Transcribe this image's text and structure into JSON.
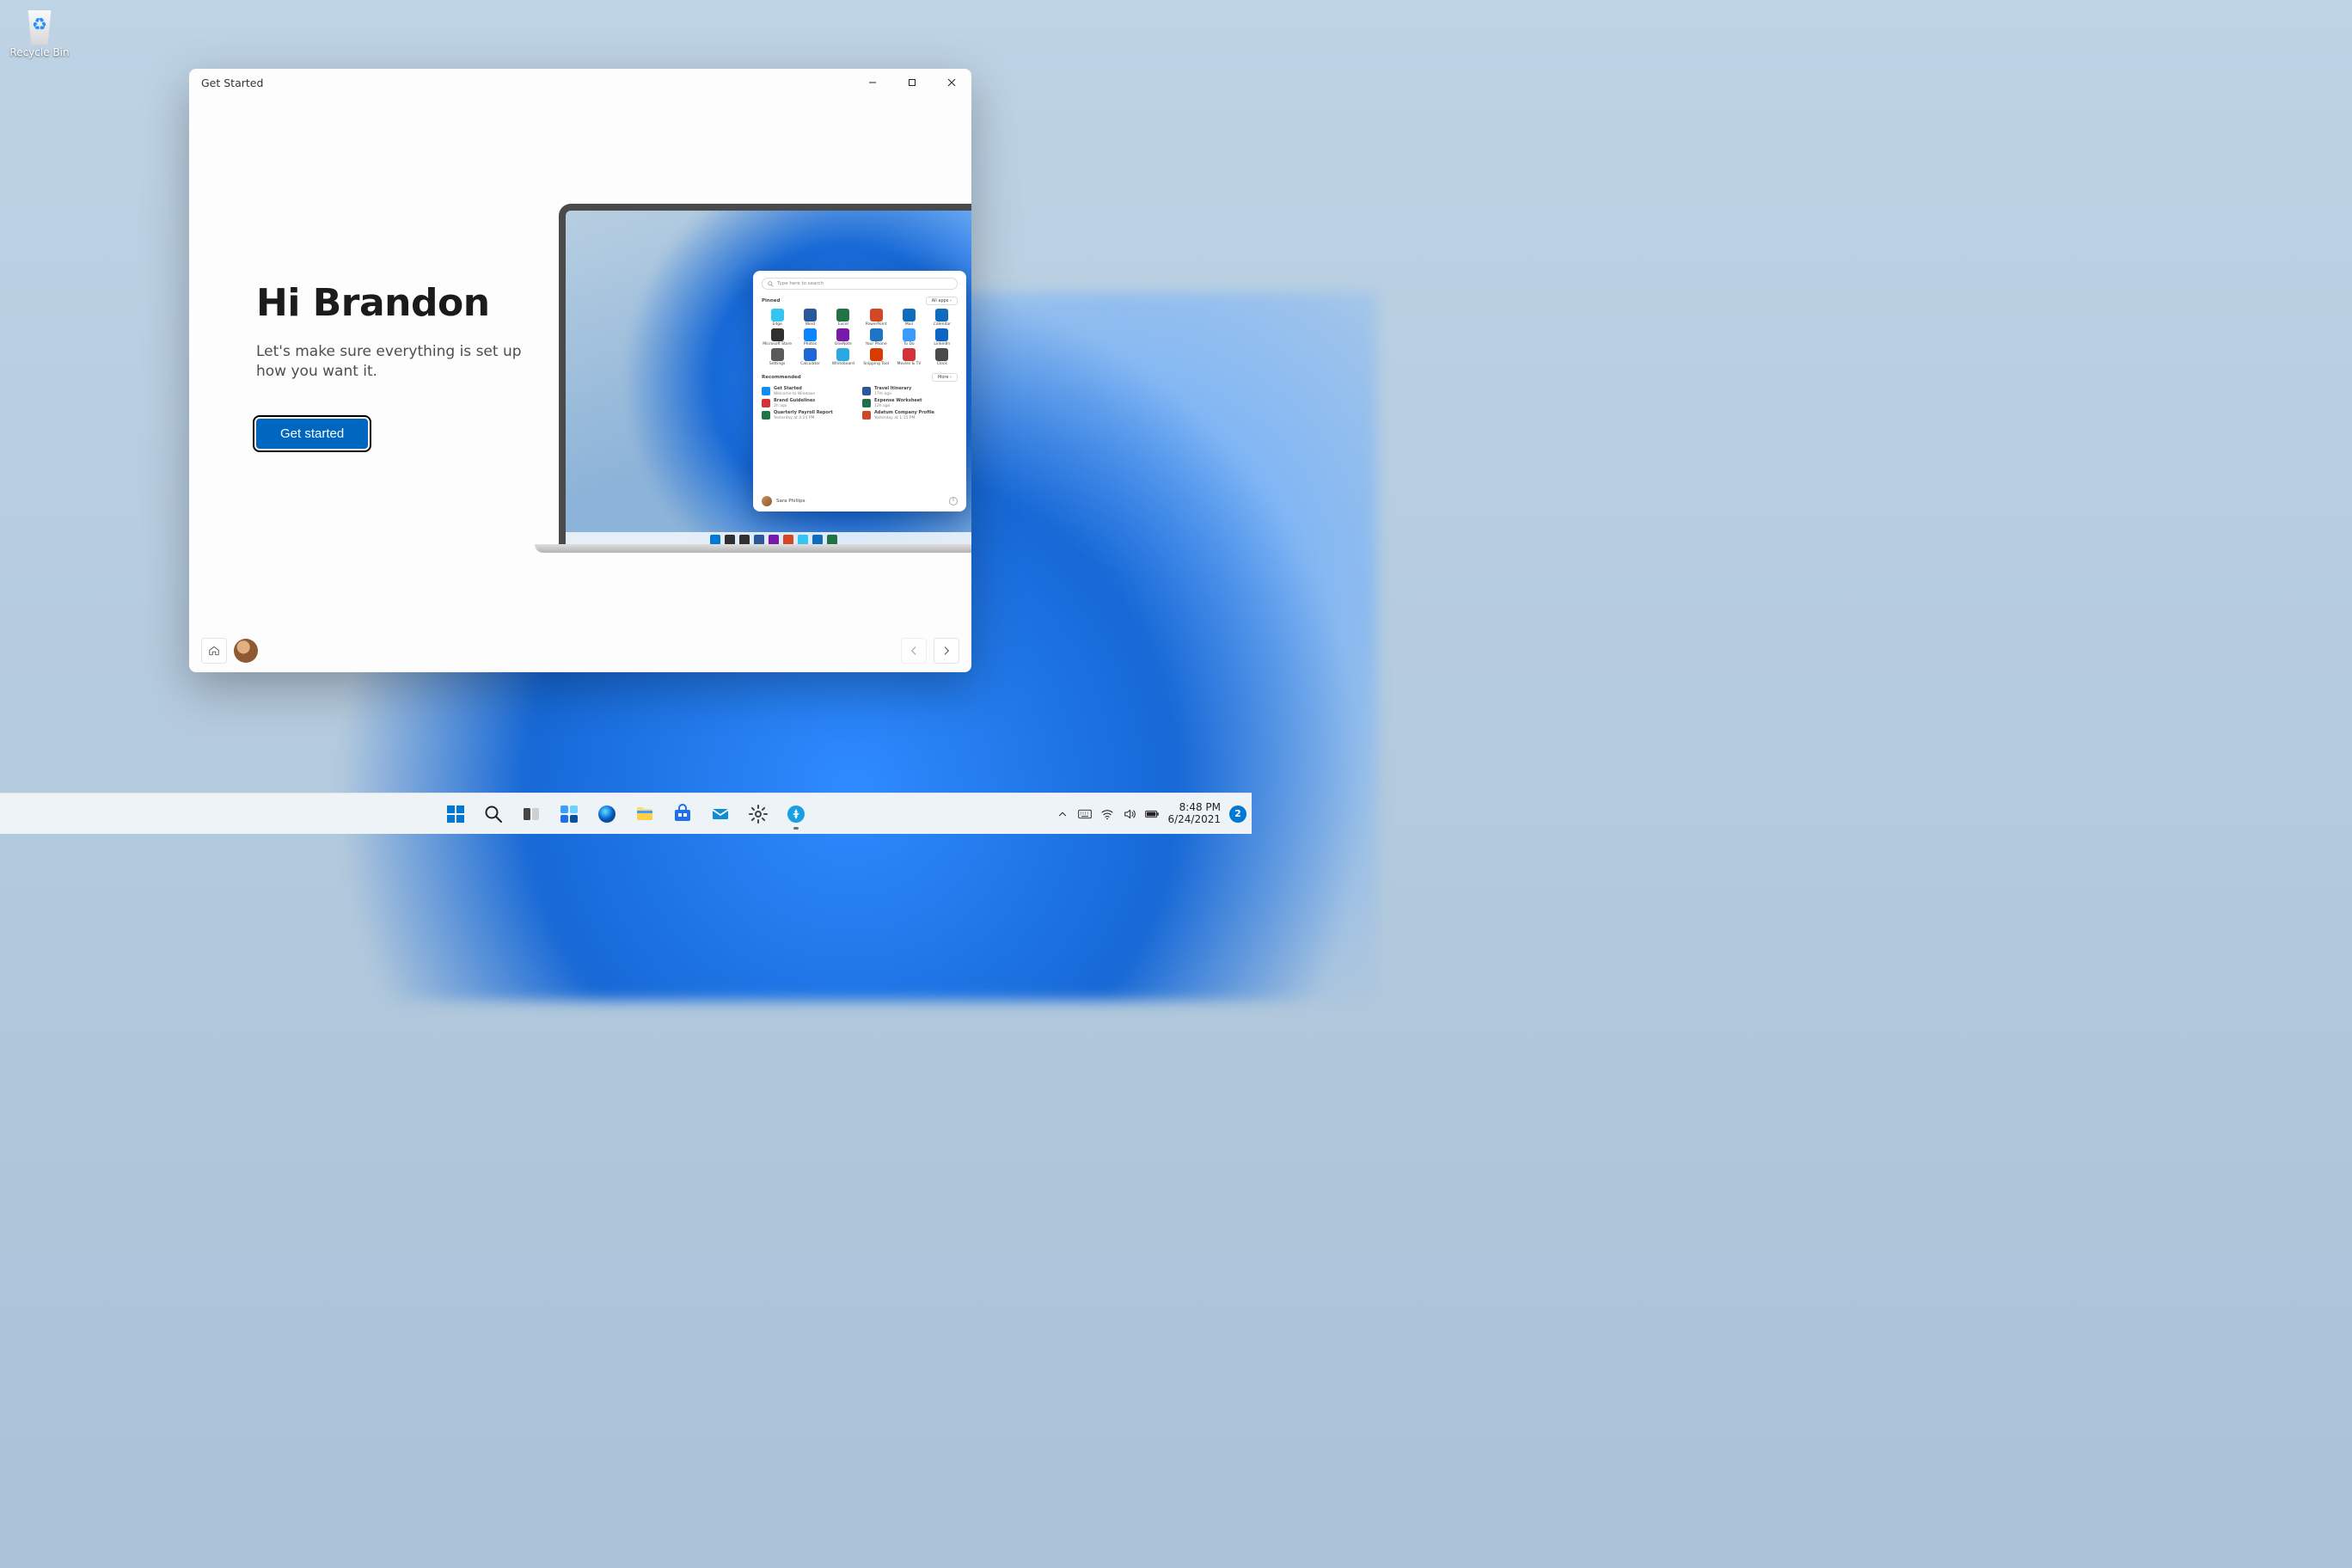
{
  "desktop": {
    "recycle_bin_label": "Recycle Bin"
  },
  "window": {
    "title": "Get Started",
    "greeting": "Hi Brandon",
    "subhead": "Let's make sure everything is set up how you want it.",
    "cta": "Get started"
  },
  "hero_start_menu": {
    "search_placeholder": "Type here to search",
    "pinned_label": "Pinned",
    "all_apps_label": "All apps",
    "recommended_label": "Recommended",
    "more_label": "More",
    "user_name": "Sara Phillips",
    "pinned": [
      {
        "label": "Edge",
        "color": "#35c3f0"
      },
      {
        "label": "Word",
        "color": "#2b579a"
      },
      {
        "label": "Excel",
        "color": "#217346"
      },
      {
        "label": "PowerPoint",
        "color": "#d24726"
      },
      {
        "label": "Mail",
        "color": "#0f6cbd"
      },
      {
        "label": "Calendar",
        "color": "#0f6cbd"
      },
      {
        "label": "Microsoft Store",
        "color": "#303030"
      },
      {
        "label": "Photos",
        "color": "#0a84ff"
      },
      {
        "label": "OneNote",
        "color": "#7719aa"
      },
      {
        "label": "Your Phone",
        "color": "#1b74c5"
      },
      {
        "label": "To Do",
        "color": "#3a9bff"
      },
      {
        "label": "LinkedIn",
        "color": "#0a66c2"
      },
      {
        "label": "Settings",
        "color": "#5a5a5a"
      },
      {
        "label": "Calculator",
        "color": "#2067d4"
      },
      {
        "label": "Whiteboard",
        "color": "#2aa8e0"
      },
      {
        "label": "Snipping Tool",
        "color": "#d83b01"
      },
      {
        "label": "Movies & TV",
        "color": "#d13438"
      },
      {
        "label": "Clock",
        "color": "#4a4a4a"
      }
    ],
    "recommended": [
      {
        "title": "Get Started",
        "sub": "Welcome to Windows",
        "color": "#0f8ff0"
      },
      {
        "title": "Travel Itinerary",
        "sub": "17m ago",
        "color": "#2b579a"
      },
      {
        "title": "Brand Guidelines",
        "sub": "2h ago",
        "color": "#d13438"
      },
      {
        "title": "Expense Worksheet",
        "sub": "12h ago",
        "color": "#217346"
      },
      {
        "title": "Quarterly Payroll Report",
        "sub": "Yesterday at 4:24 PM",
        "color": "#217346"
      },
      {
        "title": "Adatum Company Profile",
        "sub": "Yesterday at 1:15 PM",
        "color": "#d24726"
      }
    ],
    "mini_taskbar_colors": [
      "#0078d4",
      "#303030",
      "#303030",
      "#2b579a",
      "#7719aa",
      "#d24726",
      "#35c3f0",
      "#0f6cbd",
      "#217346"
    ]
  },
  "taskbar": {
    "items": [
      {
        "name": "start",
        "color": "#0078d4"
      },
      {
        "name": "search",
        "color": "#303030"
      },
      {
        "name": "task-view",
        "color": "#2b2b2b"
      },
      {
        "name": "widgets",
        "color": "#0067c0"
      },
      {
        "name": "edge",
        "color": "#35c3f0"
      },
      {
        "name": "file-explorer",
        "color": "#ffcf48"
      },
      {
        "name": "store",
        "color": "#1f6feb"
      },
      {
        "name": "mail",
        "color": "#0f6cbd"
      },
      {
        "name": "settings",
        "color": "#5a5a5a"
      },
      {
        "name": "get-started",
        "color": "#18a0e2"
      }
    ],
    "tray_chevron": "⌃",
    "clock_time": "8:48 PM",
    "clock_date": "6/24/2021",
    "notification_count": "2"
  }
}
